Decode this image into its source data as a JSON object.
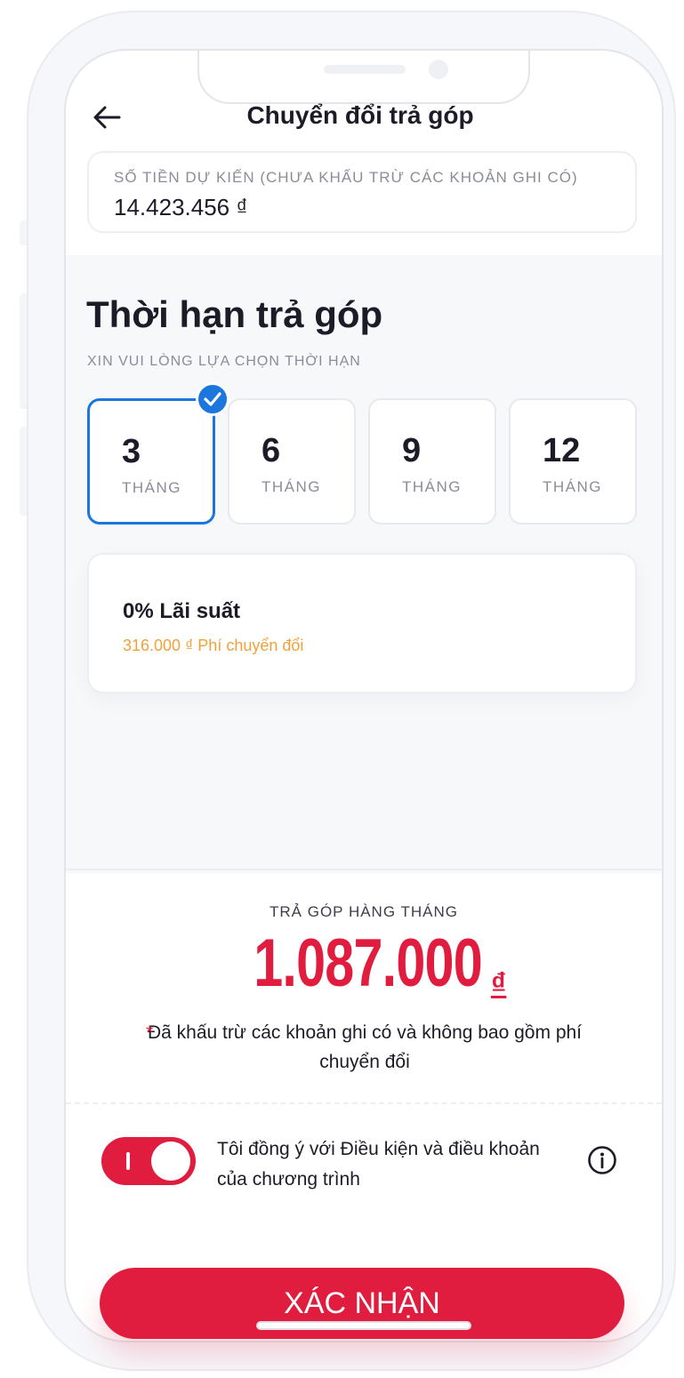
{
  "header": {
    "title": "Chuyển đổi trả góp"
  },
  "amount": {
    "label": "SỐ TIỀN DỰ KIẾN (CHƯA KHẤU TRỪ CÁC KHOẢN GHI CÓ)",
    "value": "14.423.456 ₫"
  },
  "term_section": {
    "title": "Thời hạn trả góp",
    "subtitle": "XIN VUI LÒNG LỰA CHỌN THỜI HẠN",
    "options": [
      {
        "value": "3",
        "unit": "THÁNG",
        "selected": true
      },
      {
        "value": "6",
        "unit": "THÁNG",
        "selected": false
      },
      {
        "value": "9",
        "unit": "THÁNG",
        "selected": false
      },
      {
        "value": "12",
        "unit": "THÁNG",
        "selected": false
      }
    ]
  },
  "info_card": {
    "rate": "0% Lãi suất",
    "fee": "316.000 ₫ Phí chuyển đổi"
  },
  "monthly": {
    "label": "TRẢ GÓP HÀNG THÁNG",
    "value": "1.087.000",
    "currency": "₫",
    "note_star": "*",
    "note": "Đã khấu trừ các khoản ghi có và không bao gồm phí chuyển đổi"
  },
  "agreement": {
    "toggle_on": true,
    "text": "Tôi đồng ý với Điều kiện và điều khoản của chương trình",
    "info_icon": "info-icon"
  },
  "confirm_button": {
    "label": "XÁC NHẬN"
  },
  "colors": {
    "accent_red": "#e11d3f",
    "selected_blue": "#1b77dd",
    "fee_orange": "#f0a23a"
  }
}
